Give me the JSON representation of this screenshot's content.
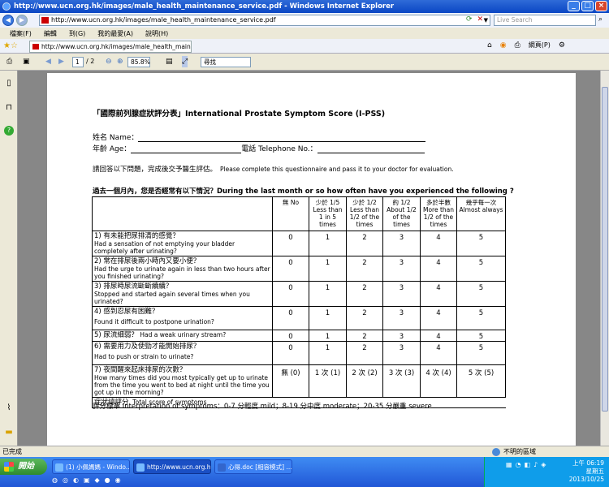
{
  "window": {
    "title": "http://www.ucn.org.hk/images/male_health_maintenance_service.pdf - Windows Internet Explorer"
  },
  "address_bar": {
    "url": "http://www.ucn.org.hk/images/male_health_maintenance_service.pdf",
    "search_placeholder": "Live Search"
  },
  "menu": [
    "檔案(F)",
    "編輯",
    "到(G)",
    "我的最愛(A)",
    "說明(H)"
  ],
  "tab": {
    "label": "http://www.ucn.org.hk/images/male_health_maintenance..."
  },
  "toolbar_right": {
    "page_label": "網頁(P)"
  },
  "pdf_toolbar": {
    "page_current": "1",
    "page_total": "/ 2",
    "zoom": "85.8%",
    "find_placeholder": "尋找"
  },
  "document": {
    "title": "「國際前列腺症狀評分表」International Prostate Symptom Score (I-PSS)",
    "name_label": "姓名 Name：",
    "age_label": "年齡 Age：",
    "phone_label": "電話 Telephone No.：",
    "instruction_zh": "請回答以下問題，完成後交予醫生評估。",
    "instruction_en": "Please complete this questionnaire and pass it to your doctor for evaluation.",
    "question_header": "過去一個月內，您是否經常有以下情況？During the last month or so how often have you experienced the following ?",
    "columns": [
      {
        "zh": "無",
        "en": "No"
      },
      {
        "zh": "少於 1/5",
        "en": "Less than 1 in 5 times"
      },
      {
        "zh": "少於 1/2",
        "en": "Less than 1/2 of the times"
      },
      {
        "zh": "約 1/2",
        "en": "About 1/2 of the times"
      },
      {
        "zh": "多於半數",
        "en": "More than 1/2 of the times"
      },
      {
        "zh": "幾乎每一次",
        "en": "Almost always"
      }
    ],
    "questions": [
      {
        "zh": "1) 有未能把尿排清的感覺？",
        "en": "Had a sensation of not emptying your bladder completely after urinating?",
        "scores": [
          "0",
          "1",
          "2",
          "3",
          "4",
          "5"
        ]
      },
      {
        "zh": "2) 常在排尿後兩小時內又要小便？",
        "en": "Had the urge to urinate again in less than two hours after you finished urinating?",
        "scores": [
          "0",
          "1",
          "2",
          "3",
          "4",
          "5"
        ]
      },
      {
        "zh": "3) 排尿時尿流斷斷續續？",
        "en": "Stopped and started again several times when you urinated?",
        "scores": [
          "0",
          "1",
          "2",
          "3",
          "4",
          "5"
        ]
      },
      {
        "zh": "4) 感到忍尿有困難？",
        "en": "Found it difficult to postpone urination?",
        "scores": [
          "0",
          "1",
          "2",
          "3",
          "4",
          "5"
        ]
      },
      {
        "zh": "5) 尿流細弱？",
        "en": "Had a weak urinary stream?",
        "scores": [
          "0",
          "1",
          "2",
          "3",
          "4",
          "5"
        ]
      },
      {
        "zh": "6) 需要用力及使勁才能開始排尿？",
        "en": "Had to push or strain to urinate?",
        "scores": [
          "0",
          "1",
          "2",
          "3",
          "4",
          "5"
        ]
      },
      {
        "zh": "7) 夜間醒來起床排尿的次數？",
        "en": "How many times did you most typically get up to urinate from the time you went to bed at night until the time you got up in the morning?",
        "scores": [
          "無 (0)",
          "1 次 (1)",
          "2 次 (2)",
          "3 次 (3)",
          "4 次 (4)",
          "5 次 (5)"
        ]
      }
    ],
    "total_zh": "症狀總評分",
    "total_en": "Total score of symptoms",
    "interpretation": "評分標準 Interpretation of symptoms：0-7 分輕度  mild；8-19 分中度 moderate；20-35 分嚴重  severe"
  },
  "statusbar": {
    "left": "已完成",
    "zone": "不明的區域"
  },
  "taskbar": {
    "start": "開始",
    "tasks": [
      "(1) 小佩媽媽 - Windo...",
      "http://www.ucn.org.hk...",
      "心得.doc [相容模式] ..."
    ],
    "time": "上午 06:19",
    "weekday": "星期五",
    "date": "2013/10/25"
  }
}
